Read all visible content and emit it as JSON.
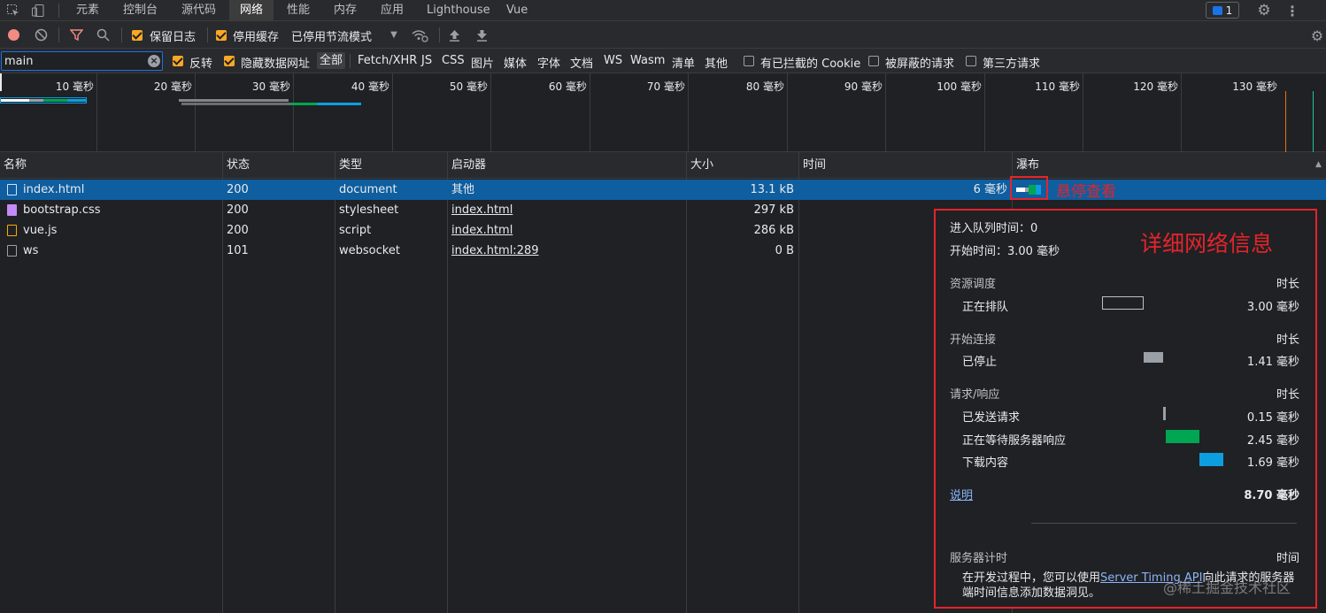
{
  "tabs": [
    "元素",
    "控制台",
    "源代码",
    "网络",
    "性能",
    "内存",
    "应用",
    "Lighthouse",
    "Vue"
  ],
  "issues_count": "1",
  "toolbar": {
    "preserve_log": "保留日志",
    "disable_cache": "停用缓存",
    "throttle": "已停用节流模式"
  },
  "filter": {
    "value": "main",
    "invert": "反转",
    "hide_data_urls": "隐藏数据网址",
    "types": [
      "全部",
      "Fetch/XHR",
      "JS",
      "CSS",
      "图片",
      "媒体",
      "字体",
      "文档",
      "WS",
      "Wasm",
      "清单",
      "其他"
    ],
    "blocked_cookies": "有已拦截的 Cookie",
    "blocked_requests": "被屏蔽的请求",
    "third_party": "第三方请求"
  },
  "overview_ticks": [
    "10 毫秒",
    "20 毫秒",
    "30 毫秒",
    "40 毫秒",
    "50 毫秒",
    "60 毫秒",
    "70 毫秒",
    "80 毫秒",
    "90 毫秒",
    "100 毫秒",
    "110 毫秒",
    "120 毫秒",
    "130 毫秒"
  ],
  "columns": [
    "名称",
    "状态",
    "类型",
    "启动器",
    "大小",
    "时间",
    "瀑布"
  ],
  "rows": [
    {
      "name": "index.html",
      "status": "200",
      "type": "document",
      "initiator": "其他",
      "size": "13.1 kB",
      "time": "6 毫秒"
    },
    {
      "name": "bootstrap.css",
      "status": "200",
      "type": "stylesheet",
      "initiator": "index.html",
      "size": "297 kB",
      "time": ""
    },
    {
      "name": "vue.js",
      "status": "200",
      "type": "script",
      "initiator": "index.html",
      "size": "286 kB",
      "time": ""
    },
    {
      "name": "ws",
      "status": "101",
      "type": "websocket",
      "initiator": "index.html:289",
      "size": "0 B",
      "time": ""
    }
  ],
  "annotation_hover": "悬停查看",
  "annotation_detail": "详细网络信息",
  "popup": {
    "queued_at": "进入队列时间：0",
    "started_at": "开始时间：3.00 毫秒",
    "sec1": "资源调度",
    "sec1_right": "时长",
    "queueing": "正在排队",
    "queueing_v": "3.00 毫秒",
    "sec2": "开始连接",
    "sec2_right": "时长",
    "stalled": "已停止",
    "stalled_v": "1.41 毫秒",
    "sec3": "请求/响应",
    "sec3_right": "时长",
    "request_sent": "已发送请求",
    "request_sent_v": "0.15 毫秒",
    "waiting": "正在等待服务器响应",
    "waiting_v": "2.45 毫秒",
    "download": "下载内容",
    "download_v": "1.69 毫秒",
    "explain": "说明",
    "total": "8.70 毫秒",
    "server_timing": "服务器计时",
    "server_timing_right": "时间",
    "st_text_1": "在开发过程中，您可以使用",
    "st_link": "Server Timing API",
    "st_text_2": "向此请求的服务器",
    "st_text_3": "端时间信息添加数据洞见。"
  },
  "watermark": "@稀土掘金技术社区",
  "colors": {
    "selected_row": "#0e5ea0",
    "annotation": "#e3242b",
    "waiting": "#00a651",
    "download": "#0d9ee0"
  }
}
